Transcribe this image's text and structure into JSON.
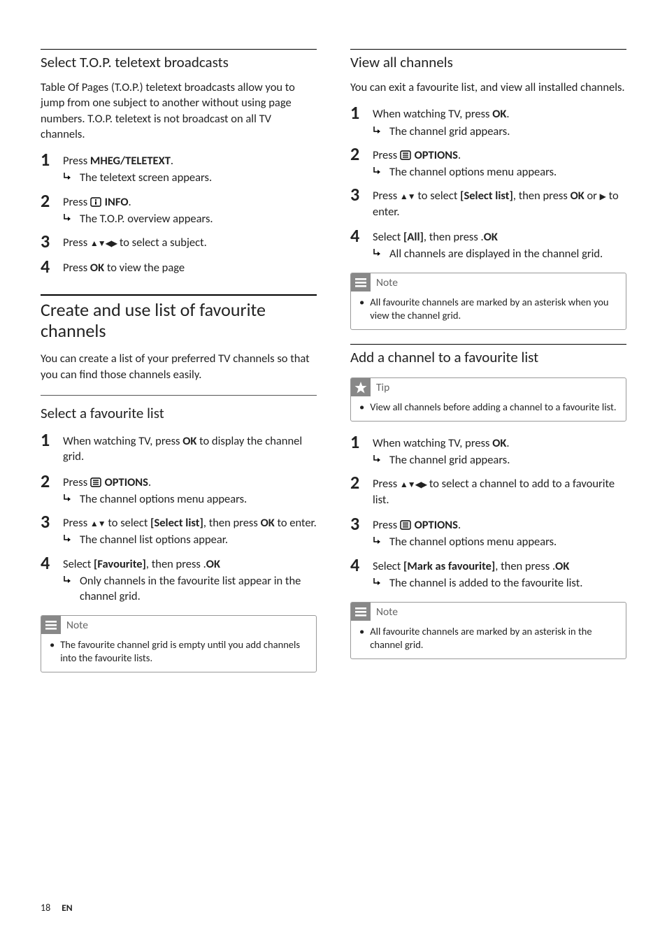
{
  "left": {
    "top_heading": "Select T.O.P. teletext broadcasts",
    "top_intro": "Table Of Pages (T.O.P.) teletext broadcasts allow you to jump from one subject to another without using page numbers. T.O.P. teletext is not broadcast on all TV channels.",
    "top_steps": [
      {
        "num": "1",
        "pre": "Press ",
        "bold": "MHEG/TELETEXT",
        "post": ".",
        "result": "The teletext screen appears."
      },
      {
        "num": "2",
        "pre": "Press ",
        "icon": "info",
        "bold": "INFO",
        "post": ".",
        "result": "The T.O.P. overview appears."
      },
      {
        "num": "3",
        "pre": "Press ",
        "arrows": "udlr",
        "post_plain": " to select a subject."
      },
      {
        "num": "4",
        "pre": "Press ",
        "bold": "OK",
        "post_plain": " to view the page"
      }
    ],
    "fav_heading": "Create and use list of favourite channels",
    "fav_intro": "You can create a list of your preferred TV channels so that you can find those channels easily.",
    "select_heading": "Select a favourite list",
    "select_steps": [
      {
        "num": "1",
        "pre": "When watching TV, press ",
        "bold": "OK",
        "post_plain": " to display the channel grid."
      },
      {
        "num": "2",
        "pre": "Press ",
        "icon": "opt",
        "bold": "OPTIONS",
        "post": ".",
        "result": "The channel options menu appears."
      },
      {
        "num": "3",
        "pre": "Press ",
        "arrows": "ud",
        "mid": " to select ",
        "bold2": "[Select list]",
        "post_plain2": ", then press ",
        "bold3": "OK",
        "post_plain3": " to enter.",
        "result": "The channel list options appear."
      },
      {
        "num": "4",
        "pre": "Select ",
        "bold": "[Favourite]",
        "post_plain": ", then press ",
        "bold2_simple": "OK",
        "post_plain2": ".",
        "result": "Only channels in the favourite list appear in the channel grid."
      }
    ],
    "note_label": "Note",
    "note_text": "The favourite channel grid is empty until you add channels into the favourite lists."
  },
  "right": {
    "view_heading": "View all channels",
    "view_intro": "You can exit a favourite list, and view all installed channels.",
    "view_steps": [
      {
        "num": "1",
        "pre": "When watching TV, press ",
        "bold": "OK",
        "post": ".",
        "result": "The channel grid appears."
      },
      {
        "num": "2",
        "pre": "Press ",
        "icon": "opt",
        "bold": "OPTIONS",
        "post": ".",
        "result": "The channel options menu appears."
      },
      {
        "num": "3",
        "pre": "Press ",
        "arrows": "ud",
        "mid": " to select ",
        "bold2": "[Select list]",
        "post_plain2": ", then press ",
        "bold3": "OK",
        "mid2": " or ",
        "arrow_r": true,
        "post_plain3": " to enter."
      },
      {
        "num": "4",
        "pre": "Select ",
        "bold": "[All]",
        "post_plain": ", then press ",
        "bold2_simple": "OK",
        "post_plain2": ".",
        "result": "All channels are displayed in the channel grid."
      }
    ],
    "note1_label": "Note",
    "note1_text": "All favourite channels are marked by an asterisk when you view the channel grid.",
    "add_heading": "Add a channel to a favourite list",
    "tip_label": "Tip",
    "tip_text": "View all channels before adding a channel to a favourite list.",
    "add_steps": [
      {
        "num": "1",
        "pre": "When watching TV, press ",
        "bold": "OK",
        "post": ".",
        "result": "The channel grid appears."
      },
      {
        "num": "2",
        "pre": "Press ",
        "arrows": "udlr",
        "post_plain": " to select a channel to add to a favourite list."
      },
      {
        "num": "3",
        "pre": "Press ",
        "icon": "opt",
        "bold": "OPTIONS",
        "post": ".",
        "result": "The channel options menu appears."
      },
      {
        "num": "4",
        "pre": "Select ",
        "bold": "[Mark as favourite]",
        "post_plain": ", then press ",
        "bold2_simple": "OK",
        "post_plain2": ".",
        "result": "The channel is added to the favourite list."
      }
    ],
    "note2_label": "Note",
    "note2_text": "All favourite channels are marked by an asterisk in the channel grid."
  },
  "footer": {
    "page": "18",
    "lang": "EN"
  }
}
